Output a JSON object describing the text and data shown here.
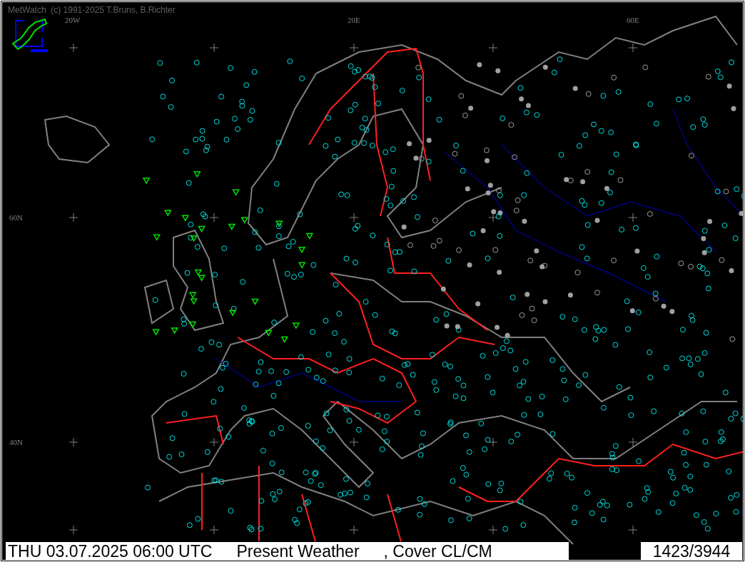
{
  "window": {
    "title": "MetWatch  (c) 1991-2025 T.Bruns, B.Richter"
  },
  "grid_labels": [
    "20W",
    "20E",
    "60E",
    "60N",
    "40N"
  ],
  "status_bar": {
    "datetime": "THU 03.07.2025 06:00 UTC",
    "parameter": "Present Weather",
    "overlay": ", Cover CL/CM",
    "count": "1423/3944"
  }
}
